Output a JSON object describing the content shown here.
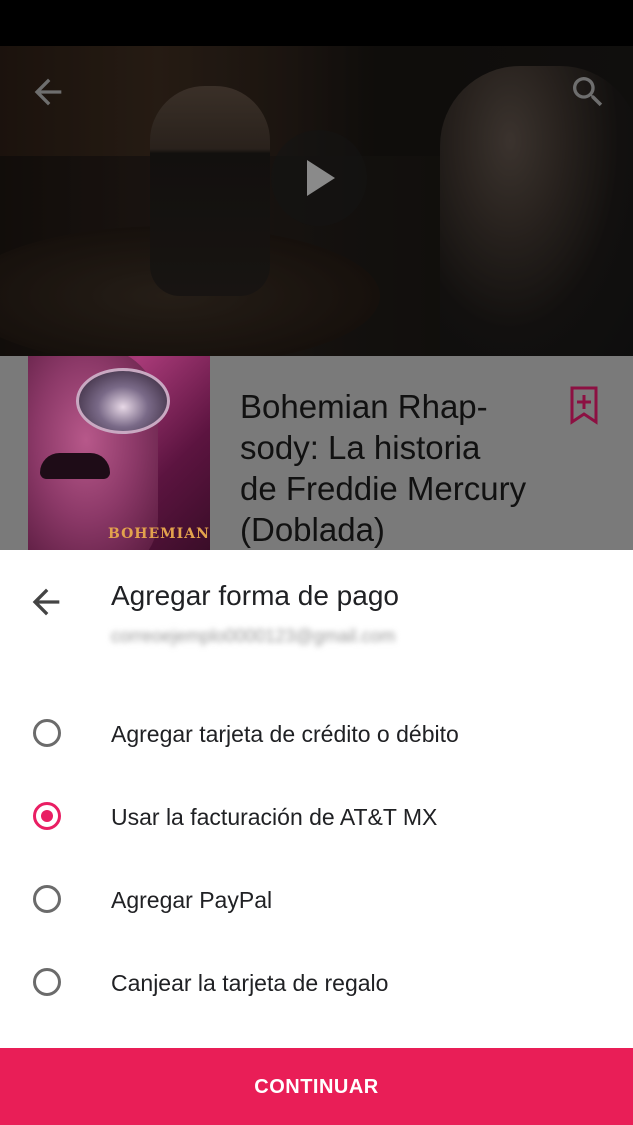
{
  "movie": {
    "title": "Bohemian Rhap-\nsody: La historia\nde Freddie Mercury\n(Doblada)",
    "poster_text": "BOHEMIAN"
  },
  "icons": {
    "top_back": "arrow-back-icon",
    "top_search": "search-icon",
    "play": "play-icon",
    "bookmark": "bookmark-add-icon",
    "sheet_back": "arrow-back-icon"
  },
  "sheet": {
    "title": "Agregar forma de pago",
    "account_email": "correoejemplo0000123@gmail.com",
    "options": [
      {
        "label": "Agregar tarjeta de crédito o débito",
        "selected": false
      },
      {
        "label": "Usar la facturación de AT&T MX",
        "selected": true
      },
      {
        "label": "Agregar PayPal",
        "selected": false
      },
      {
        "label": "Canjear la tarjeta de regalo",
        "selected": false
      }
    ],
    "continue_label": "CONTINUAR"
  },
  "colors": {
    "accent": "#e91e63",
    "button": "#e91e57",
    "bookmark": "#c2185b"
  }
}
